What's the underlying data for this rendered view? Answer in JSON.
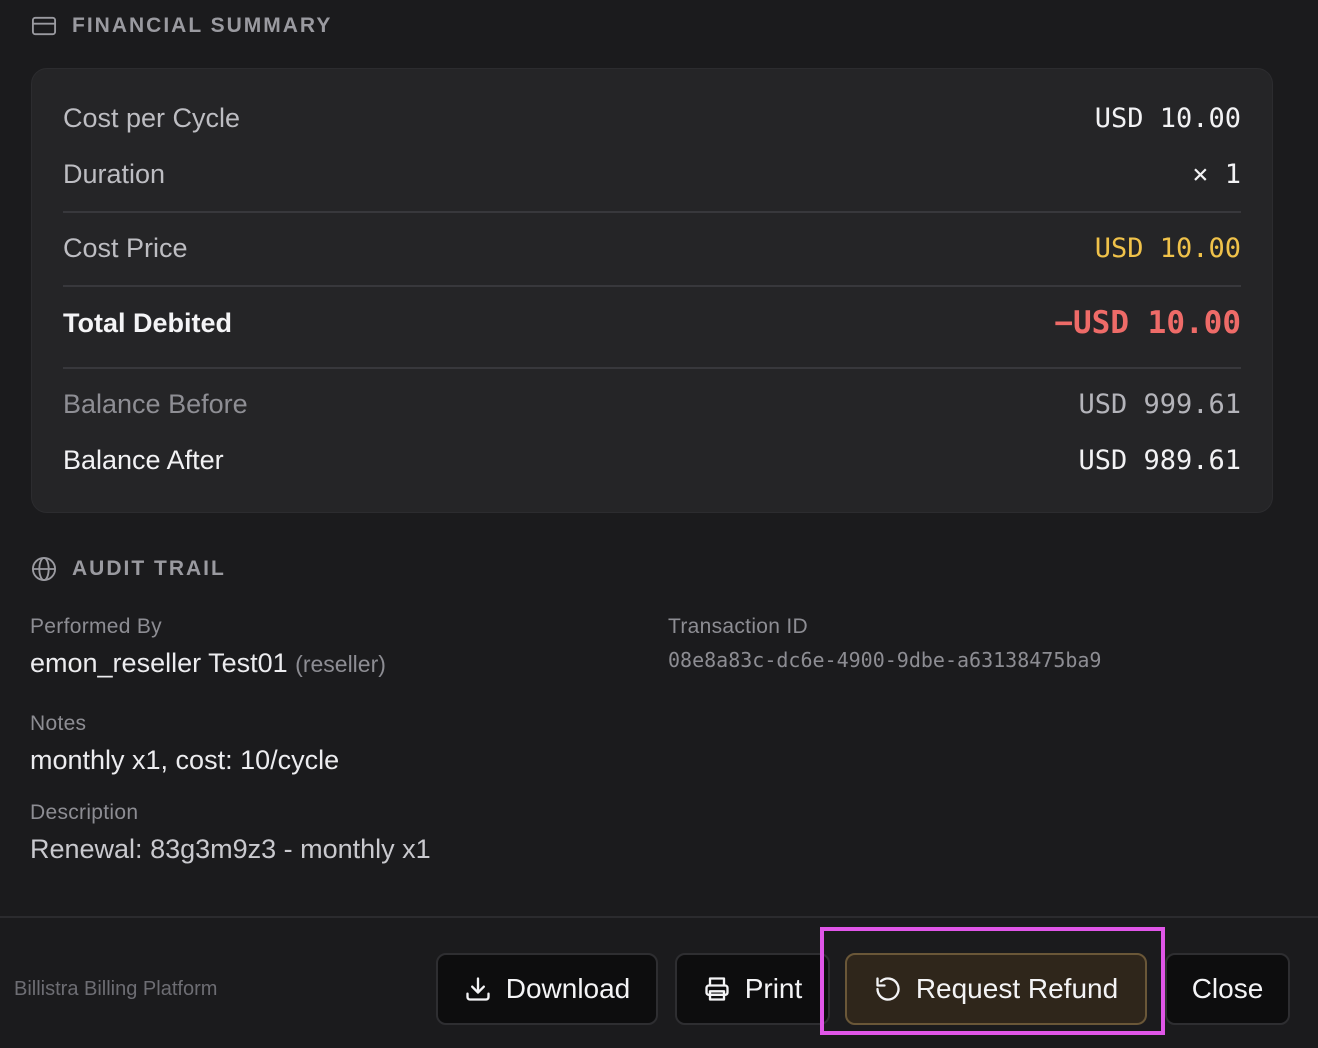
{
  "financial_summary": {
    "title": "FINANCIAL SUMMARY",
    "cost_per_cycle": {
      "label": "Cost per Cycle",
      "value": "USD 10.00"
    },
    "duration": {
      "label": "Duration",
      "value": "× 1"
    },
    "cost_price": {
      "label": "Cost Price",
      "value": "USD 10.00"
    },
    "total_debited": {
      "label": "Total Debited",
      "value": "−USD 10.00"
    },
    "balance_before": {
      "label": "Balance Before",
      "value": "USD 999.61"
    },
    "balance_after": {
      "label": "Balance After",
      "value": "USD 989.61"
    }
  },
  "audit_trail": {
    "title": "AUDIT TRAIL",
    "performed_by": {
      "label": "Performed By",
      "name": "emon_reseller Test01",
      "role": "(reseller)"
    },
    "transaction_id": {
      "label": "Transaction ID",
      "value": "08e8a83c-dc6e-4900-9dbe-a63138475ba9"
    },
    "notes": {
      "label": "Notes",
      "value": "monthly x1, cost: 10/cycle"
    },
    "description": {
      "label": "Description",
      "value": "Renewal: 83g3m9z3 - monthly x1"
    }
  },
  "footer": {
    "brand": "Billistra Billing Platform",
    "download_label": "Download",
    "print_label": "Print",
    "refund_label": "Request Refund",
    "close_label": "Close"
  },
  "colors": {
    "accent_gold": "#f0c24a",
    "debit_red": "#ee6b68",
    "highlight": "#e056e8"
  },
  "icons": [
    "card-icon",
    "globe-icon",
    "download-icon",
    "printer-icon",
    "refund-icon"
  ]
}
